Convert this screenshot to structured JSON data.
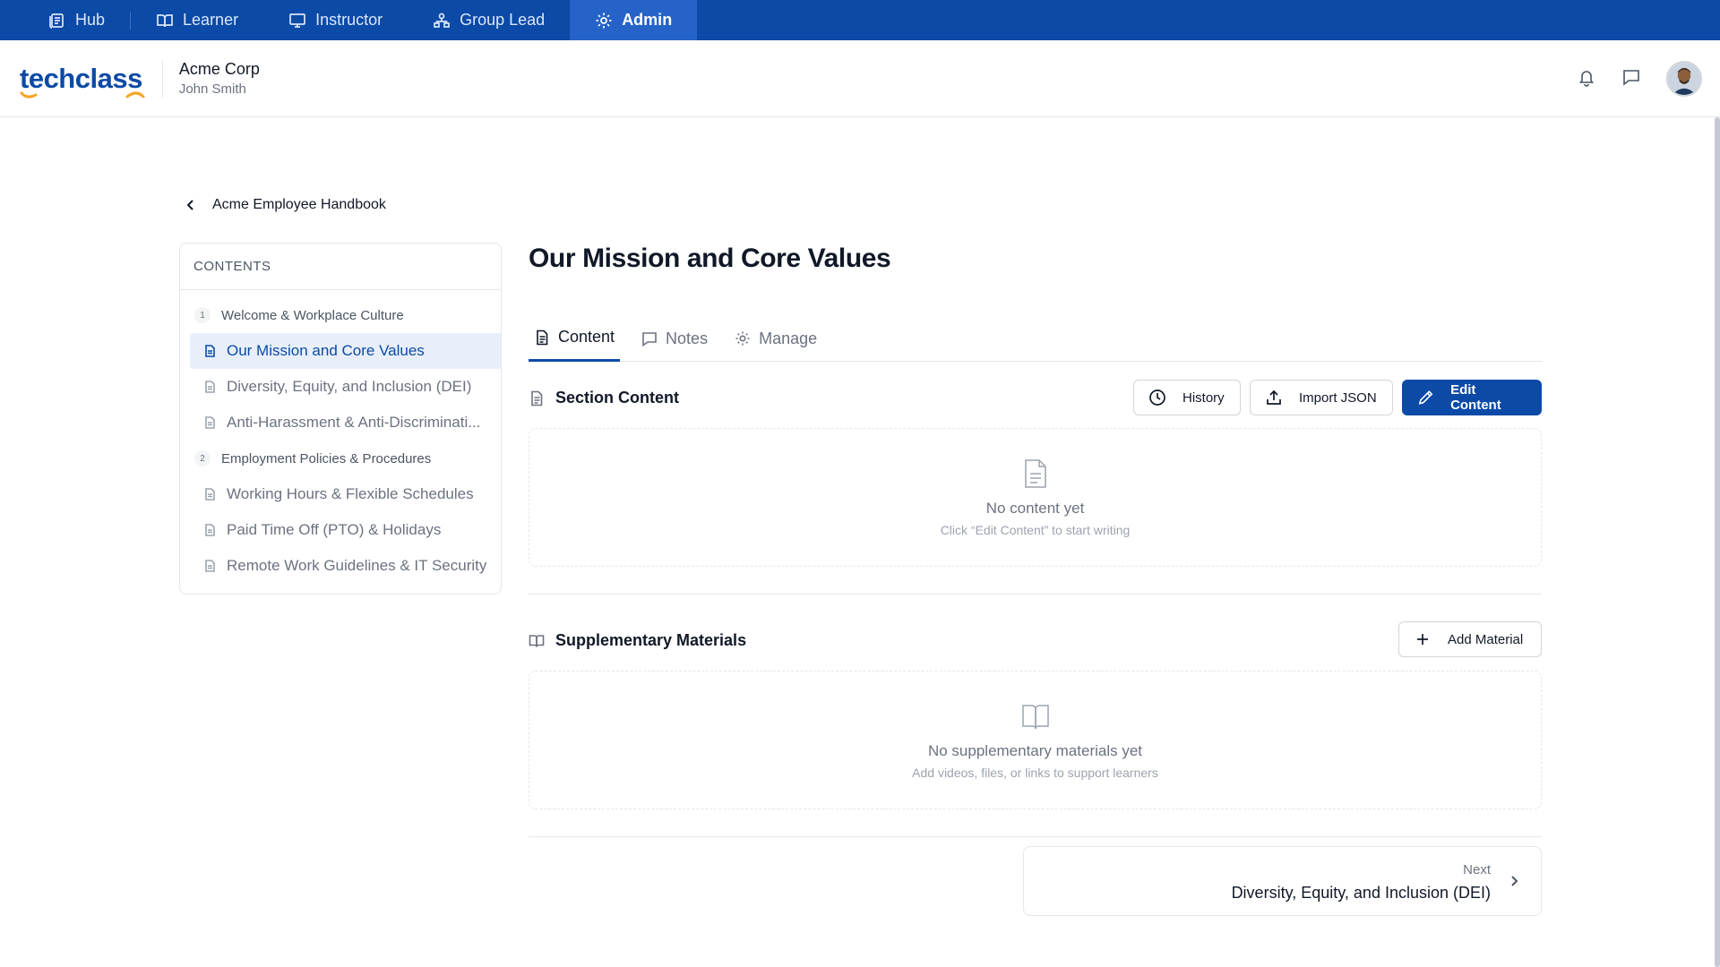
{
  "roles": [
    {
      "label": "Hub",
      "icon": "hub-icon"
    },
    {
      "label": "Learner",
      "icon": "book-icon"
    },
    {
      "label": "Instructor",
      "icon": "presentation-icon"
    },
    {
      "label": "Group Lead",
      "icon": "group-icon"
    },
    {
      "label": "Admin",
      "icon": "gear-icon",
      "active": true
    }
  ],
  "header": {
    "logo": "techclass",
    "org_name": "Acme Corp",
    "user_name": "John Smith"
  },
  "breadcrumb": {
    "label": "Acme Employee Handbook"
  },
  "contents": {
    "heading": "CONTENTS",
    "sections": [
      {
        "number": "1",
        "title": "Welcome & Workplace Culture",
        "items": [
          "Our Mission and Core Values",
          "Diversity, Equity, and Inclusion (DEI)",
          "Anti-Harassment & Anti-Discriminati..."
        ]
      },
      {
        "number": "2",
        "title": "Employment Policies & Procedures",
        "items": [
          "Working Hours & Flexible Schedules",
          "Paid Time Off (PTO) & Holidays",
          "Remote Work Guidelines & IT Security"
        ]
      }
    ],
    "active_item": "Our Mission and Core Values"
  },
  "main": {
    "title": "Our Mission and Core Values",
    "tabs": [
      {
        "label": "Content",
        "icon": "document-icon",
        "active": true
      },
      {
        "label": "Notes",
        "icon": "comment-icon"
      },
      {
        "label": "Manage",
        "icon": "gear-icon"
      }
    ],
    "section_content": {
      "heading": "Section Content",
      "buttons": {
        "history": "History",
        "import": "Import JSON",
        "edit": "Edit Content"
      },
      "empty_title": "No content yet",
      "empty_hint": "Click “Edit Content” to start writing"
    },
    "supplementary": {
      "heading": "Supplementary Materials",
      "add_button": "Add Material",
      "empty_title": "No supplementary materials yet",
      "empty_hint": "Add videos, files, or links to support learners"
    },
    "next": {
      "label": "Next",
      "title": "Diversity, Equity, and Inclusion (DEI)"
    }
  },
  "colors": {
    "brand": "#0b4aa6",
    "active_role": "#2563c9",
    "logo_accent": "#f5a524"
  }
}
